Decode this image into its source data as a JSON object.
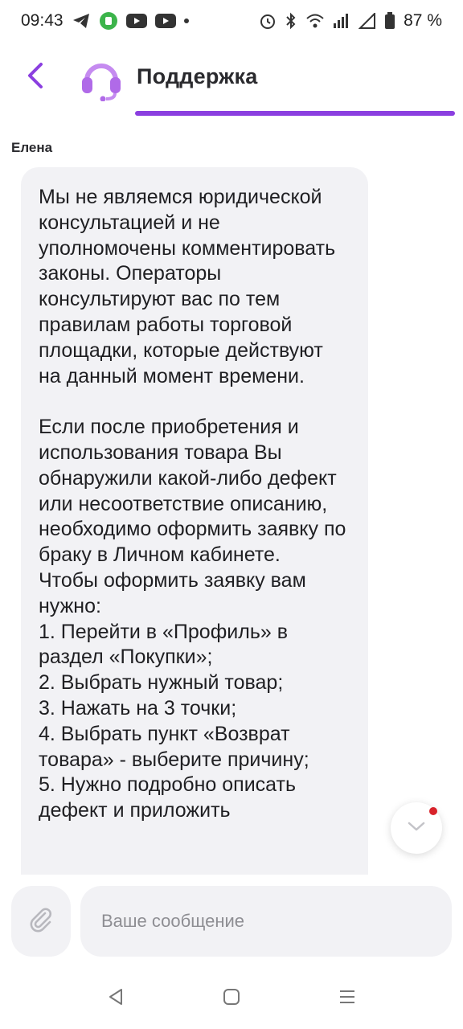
{
  "status_bar": {
    "time": "09:43",
    "battery": "87 %"
  },
  "header": {
    "title": "Поддержка"
  },
  "message": {
    "sender": "Елена",
    "text": "Мы не являемся юридической консультацией и не уполномочены комментировать законы. Операторы консультируют вас по тем правилам работы торговой площадки, которые действуют на данный момент времени.\n\nЕсли после приобретения и использования товара Вы обнаружили какой-либо дефект или несоответствие описанию, необходимо оформить заявку по браку в Личном кабинете.\nЧтобы оформить заявку вам нужно:\n1. Перейти в «Профиль» в раздел «Покупки»;\n2. Выбрать нужный товар;\n3. Нажать на 3 точки;\n4. Выбрать пункт «Возврат товара» - выберите причину;\n5. Нужно подробно описать дефект и приложить"
  },
  "input": {
    "placeholder": "Ваше сообщение"
  },
  "colors": {
    "accent": "#8b3fe0",
    "bubble_bg": "#f2f2f5",
    "unread_dot": "#d8222a"
  },
  "icons": {
    "back": "chevron-left-icon",
    "avatar": "headset-icon",
    "scroll_down": "chevron-down-icon",
    "attach": "paperclip-icon",
    "nav_back": "triangle-back-icon",
    "nav_home": "square-home-icon",
    "nav_menu": "menu-lines-icon"
  }
}
